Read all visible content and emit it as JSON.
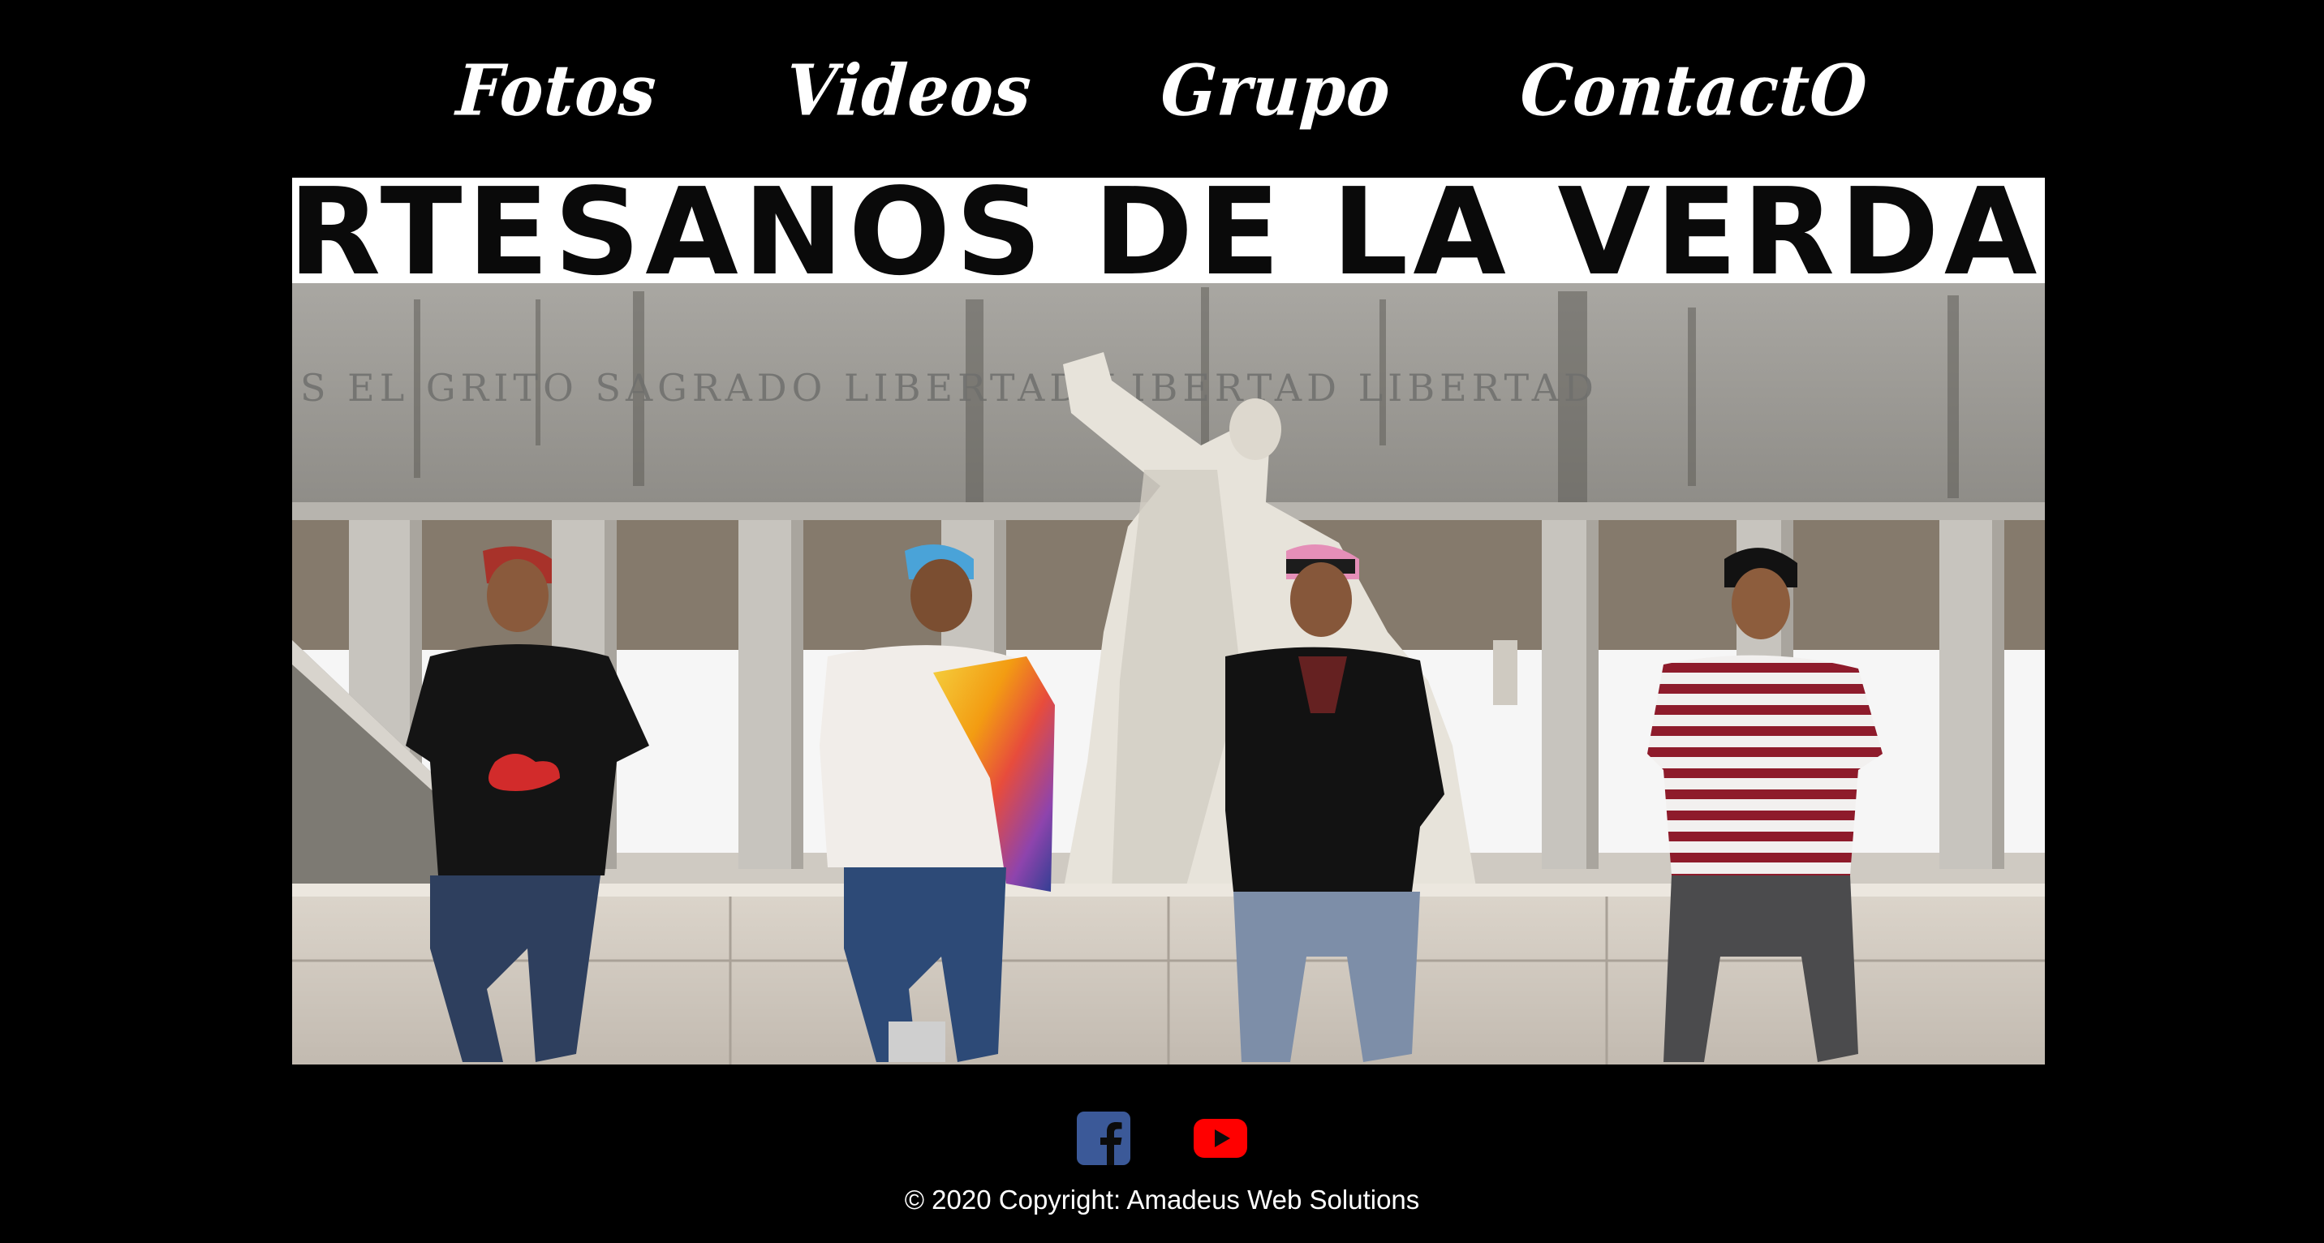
{
  "nav": {
    "items": [
      {
        "label": "Fotos"
      },
      {
        "label": "Videos"
      },
      {
        "label": "Grupo"
      },
      {
        "label": "ContactO"
      }
    ]
  },
  "hero": {
    "title": "ARTESANOS DE LA VERDAD",
    "inscription": "S EL GRITO SAGRADO LIBERTAD LIBERTAD LIBERTAD"
  },
  "social": {
    "facebook_icon": "facebook-icon",
    "youtube_icon": "youtube-icon",
    "facebook_color": "#3b5998",
    "youtube_color": "#ff0000"
  },
  "footer": {
    "copyright": "© 2020 Copyright: Amadeus Web Solutions"
  }
}
